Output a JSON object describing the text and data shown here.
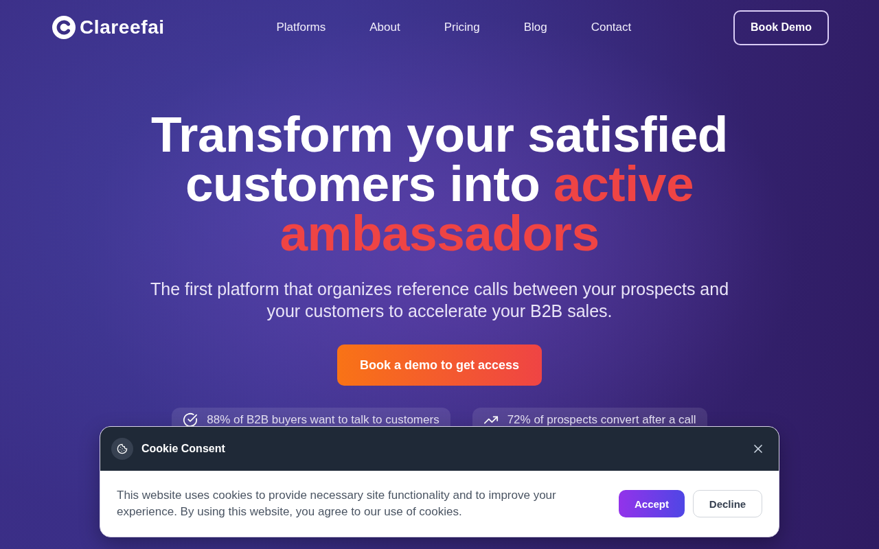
{
  "header": {
    "logo": {
      "text": "Clareefai"
    },
    "nav": [
      {
        "label": "Platforms"
      },
      {
        "label": "About"
      },
      {
        "label": "Pricing"
      },
      {
        "label": "Blog"
      },
      {
        "label": "Contact"
      }
    ],
    "cta": {
      "label": "Book Demo"
    }
  },
  "hero": {
    "title": "Transform your satisfied customers into",
    "title_highlight": "active ambassadors",
    "subtitle": "The first platform that organizes reference calls between your prospects and your customers to accelerate your B2B sales.",
    "cta": {
      "label": "Book a demo to get access"
    },
    "stats": [
      {
        "kind": "check",
        "text": "88% of B2B buyers want to talk to customers"
      },
      {
        "kind": "trend",
        "text": "72% of prospects convert after a call"
      }
    ]
  },
  "cookie_banner": {
    "title": "Cookie Consent",
    "message": "This website uses cookies to provide necessary site functionality and to improve your experience. By using this website, you agree to our use of cookies.",
    "buttons": [
      {
        "kind": "primary",
        "label": "Accept"
      },
      {
        "kind": "secondary",
        "label": "Decline"
      }
    ]
  }
}
